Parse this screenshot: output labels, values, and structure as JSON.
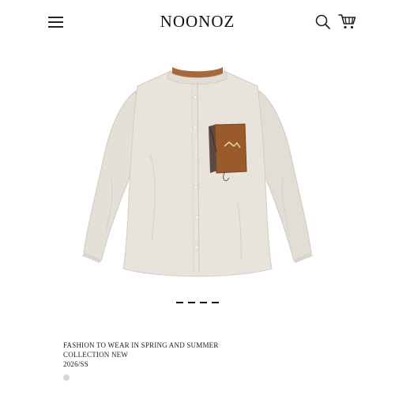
{
  "header": {
    "logo": "NOONOZ",
    "icons": {
      "menu": "hamburger-menu-icon",
      "search": "search-icon",
      "cart": "shopping-cart-icon"
    }
  },
  "hero": {
    "product": "shirt-image",
    "colors": {
      "shirt": "#e6e2d9",
      "collar_inner": "#a8693a",
      "pocket": "#9a5a2a"
    }
  },
  "pager": {
    "count": 4,
    "active_index": 0
  },
  "caption": {
    "line1": "FASHION TO WEAR IN SPRING AND SUMMER",
    "line2": "COLLECTION NEW",
    "line3": "2026/SS"
  }
}
